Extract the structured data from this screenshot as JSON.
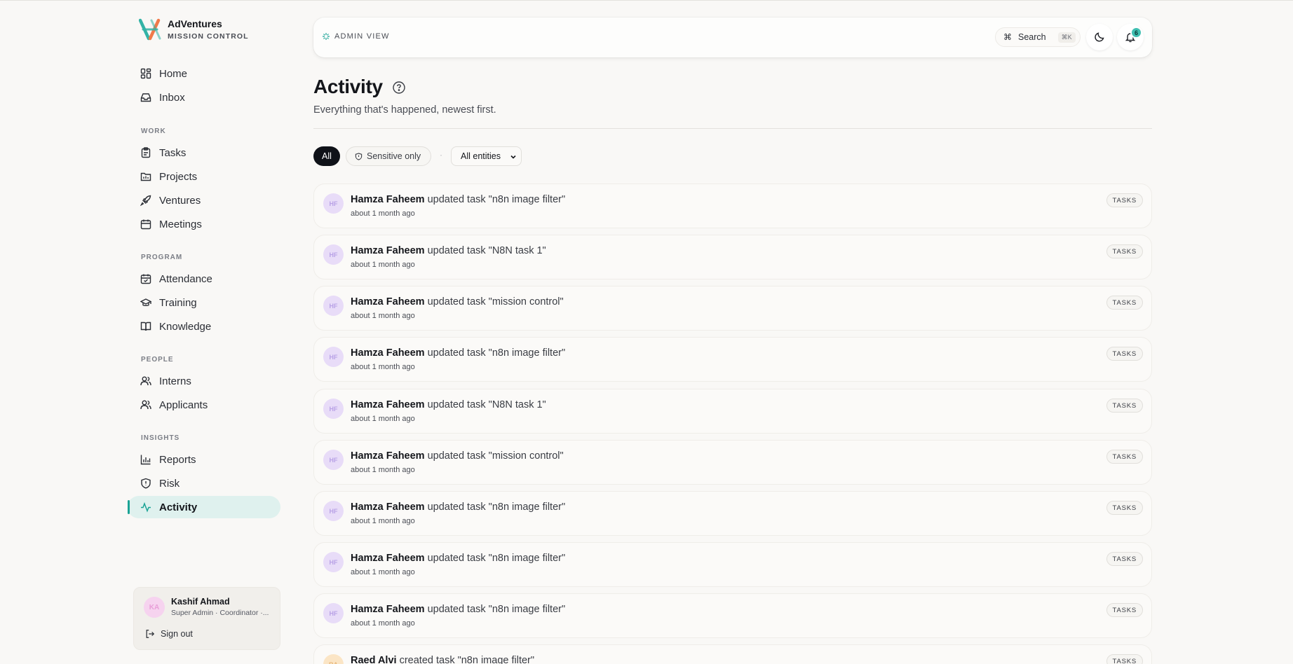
{
  "brand": {
    "name": "AdVentures",
    "subtitle": "MISSION CONTROL"
  },
  "sidebar": {
    "items": [
      {
        "label": "Home"
      },
      {
        "label": "Inbox"
      },
      {
        "label": "Tasks"
      },
      {
        "label": "Projects"
      },
      {
        "label": "Ventures"
      },
      {
        "label": "Meetings"
      },
      {
        "label": "Attendance"
      },
      {
        "label": "Training"
      },
      {
        "label": "Knowledge"
      },
      {
        "label": "Interns"
      },
      {
        "label": "Applicants"
      },
      {
        "label": "Reports"
      },
      {
        "label": "Risk"
      },
      {
        "label": "Activity"
      }
    ],
    "sections": {
      "work": "WORK",
      "program": "PROGRAM",
      "people": "PEOPLE",
      "insights": "INSIGHTS"
    },
    "active": "Activity"
  },
  "user": {
    "initials": "KA",
    "name": "Kashif Ahmad",
    "role": "Super Admin · Coordinator ·...",
    "signout_label": "Sign out"
  },
  "topbar": {
    "view_label": "ADMIN VIEW",
    "search_label": "Search",
    "search_symbol": "⌘",
    "search_shortcut": "⌘K",
    "notification_count": "6"
  },
  "page": {
    "title": "Activity",
    "subtitle": "Everything that's happened, newest first."
  },
  "filters": {
    "all_label": "All",
    "sensitive_label": "Sensitive only",
    "separator": "·",
    "entity_select": "All entities"
  },
  "activity": [
    {
      "initials": "HF",
      "actor": "Hamza Faheem",
      "action": "updated task \"n8n image filter\"",
      "time": "about 1 month ago",
      "tag": "TASKS"
    },
    {
      "initials": "HF",
      "actor": "Hamza Faheem",
      "action": "updated task \"N8N task 1\"",
      "time": "about 1 month ago",
      "tag": "TASKS"
    },
    {
      "initials": "HF",
      "actor": "Hamza Faheem",
      "action": "updated task \"mission control\"",
      "time": "about 1 month ago",
      "tag": "TASKS"
    },
    {
      "initials": "HF",
      "actor": "Hamza Faheem",
      "action": "updated task \"n8n image filter\"",
      "time": "about 1 month ago",
      "tag": "TASKS"
    },
    {
      "initials": "HF",
      "actor": "Hamza Faheem",
      "action": "updated task \"N8N task 1\"",
      "time": "about 1 month ago",
      "tag": "TASKS"
    },
    {
      "initials": "HF",
      "actor": "Hamza Faheem",
      "action": "updated task \"mission control\"",
      "time": "about 1 month ago",
      "tag": "TASKS"
    },
    {
      "initials": "HF",
      "actor": "Hamza Faheem",
      "action": "updated task \"n8n image filter\"",
      "time": "about 1 month ago",
      "tag": "TASKS"
    },
    {
      "initials": "HF",
      "actor": "Hamza Faheem",
      "action": "updated task \"n8n image filter\"",
      "time": "about 1 month ago",
      "tag": "TASKS"
    },
    {
      "initials": "HF",
      "actor": "Hamza Faheem",
      "action": "updated task \"n8n image filter\"",
      "time": "about 1 month ago",
      "tag": "TASKS"
    },
    {
      "initials": "RA",
      "actor": "Raed Alvi",
      "action": "created task \"n8n image filter\"",
      "time": "",
      "tag": "TASKS"
    }
  ],
  "colors": {
    "accent": "#1aa395",
    "active_bg": "#dff1ee",
    "dark": "#0f1218",
    "badge": "#3fbfb1"
  }
}
